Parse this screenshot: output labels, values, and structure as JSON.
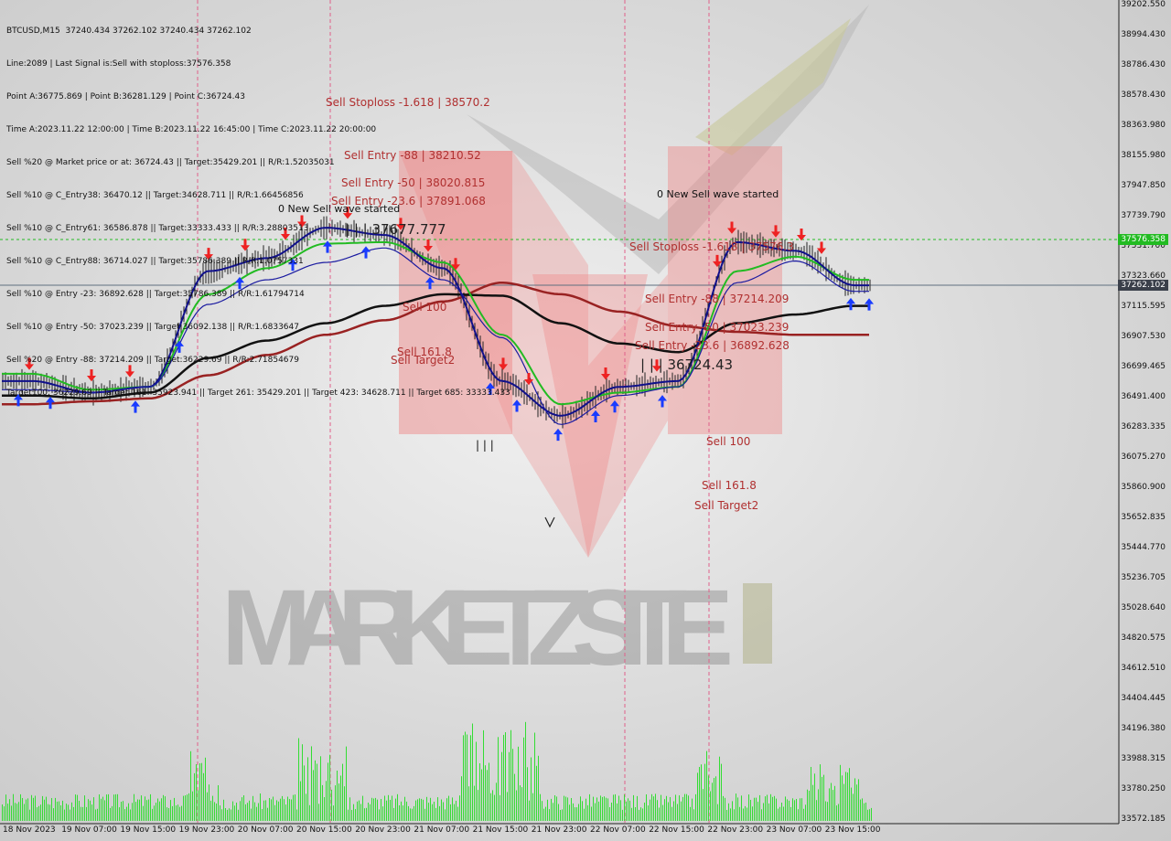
{
  "symbol_line": "BTCUSD,M15  37240.434 37262.102 37240.434 37262.102",
  "info_lines": [
    "Line:2089 | Last Signal is:Sell with stoploss:37576.358",
    "Point A:36775.869 | Point B:36281.129 | Point C:36724.43",
    "Time A:2023.11.22 12:00:00 | Time B:2023.11.22 16:45:00 | Time C:2023.11.22 20:00:00",
    "Sell %20 @ Market price or at: 36724.43 || Target:35429.201 || R/R:1.52035031",
    "Sell %10 @ C_Entry38: 36470.12 || Target:34628.711 || R/R:1.66456856",
    "Sell %10 @ C_Entry61: 36586.878 || Target:33333.433 || R/R:3.28803513",
    "Sell %10 @ C_Entry88: 36714.027 || Target:35786.389 || R/R:1.0757331",
    "Sell %10 @ Entry -23: 36892.628 || Target:35786.389 || R/R:1.61794714",
    "Sell %10 @ Entry -50: 37023.239 || Target:36092.138 || R/R:1.6833647",
    "Sell %20 @ Entry -88: 37214.209 || Target:36229.69 || R/R:2.71854679",
    "Target100: 36229.69 || Target 161: 35923.941 || Target 261: 35429.201 || Target 423: 34628.711 || Target 685: 33333.433"
  ],
  "chart_labels": {
    "left_stoploss": "Sell Stoploss -1.618 | 38570.2",
    "left_entry88": "Sell Entry -88 | 38210.52",
    "left_entry50": "Sell Entry -50 | 38020.815",
    "left_entry236": "Sell Entry -23.6 | 37891.068",
    "left_wave": "0 New Sell wave started",
    "left_price": "| | | 37677.777",
    "left_sell100": "Sell 100",
    "left_sell1618": "Sell 161.8",
    "left_target2": "Sell Target2",
    "left_ticks": "| | |",
    "right_wave": "0 New Sell wave started",
    "right_stoploss": "Sell Stoploss -1.618 | 37576.3",
    "right_entry88": "Sell Entry -88 | 37214.209",
    "right_entry50": "Sell Entry -50 | 37023.239",
    "right_entry236": "Sell Entry -23.6 | 36892.628",
    "right_price": "| | | 36724.43",
    "right_sell100": "Sell 100",
    "right_sell1618": "Sell 161.8",
    "right_target2": "Sell Target2"
  },
  "watermark": "MARKETZ SITE",
  "price_axis": [
    "39202.550",
    "38994.430",
    "38786.430",
    "38578.430",
    "38363.980",
    "38155.980",
    "37947.850",
    "37739.790",
    "37531.700",
    "37323.660",
    "37115.595",
    "36907.530",
    "36699.465",
    "36491.400",
    "36283.335",
    "36075.270",
    "35860.900",
    "35652.835",
    "35444.770",
    "35236.705",
    "35028.640",
    "34820.575",
    "34612.510",
    "34404.445",
    "34196.380",
    "33988.315",
    "33780.250",
    "33572.185"
  ],
  "time_axis": [
    "18 Nov 2023",
    "19 Nov 07:00",
    "19 Nov 15:00",
    "19 Nov 23:00",
    "20 Nov 07:00",
    "20 Nov 15:00",
    "20 Nov 23:00",
    "21 Nov 07:00",
    "21 Nov 15:00",
    "21 Nov 23:00",
    "22 Nov 07:00",
    "22 Nov 15:00",
    "22 Nov 23:00",
    "23 Nov 07:00",
    "23 Nov 15:00"
  ],
  "current_price": "37262.102",
  "stoploss_price": "37576.358",
  "colors": {
    "sell_zone": "#f08080",
    "sell_text": "#b03030",
    "volume": "#33dd33",
    "ma_green": "#22bb22",
    "ma_blue": "#10108a",
    "ma_black": "#111111",
    "ma_red": "#992222",
    "vline": "#e0608a",
    "stoploss_line": "#22bb22",
    "price_line": "#607080",
    "price_box": "#3a3f4a"
  },
  "chart_data": {
    "type": "line",
    "title": "BTCUSD,M15",
    "x": [
      "18 Nov 2023",
      "19 Nov 07:00",
      "19 Nov 15:00",
      "19 Nov 23:00",
      "20 Nov 07:00",
      "20 Nov 15:00",
      "20 Nov 23:00",
      "21 Nov 07:00",
      "21 Nov 15:00",
      "21 Nov 23:00",
      "22 Nov 07:00",
      "22 Nov 15:00",
      "22 Nov 23:00",
      "23 Nov 07:00",
      "23 Nov 15:00"
    ],
    "ylim": [
      33572.185,
      39202.55
    ],
    "series": [
      {
        "values": [
          36600,
          36520,
          36560,
          37360,
          37450,
          37660,
          37610,
          37380,
          36600,
          36360,
          36560,
          36600,
          37560,
          37500,
          37262
        ]
      },
      {
        "values": [
          36650,
          36540,
          36560,
          37200,
          37380,
          37550,
          37560,
          37420,
          36920,
          36440,
          36520,
          36560,
          37360,
          37460,
          37300
        ]
      },
      {
        "values": [
          36540,
          36520,
          36560,
          37130,
          37300,
          37420,
          37520,
          37300,
          36900,
          36300,
          36500,
          36560,
          37280,
          37430,
          37220
        ]
      },
      {
        "values": [
          36500,
          36480,
          36520,
          36760,
          36880,
          37000,
          37120,
          37200,
          37190,
          37000,
          36860,
          36800,
          37000,
          37060,
          37120
        ]
      },
      {
        "values": [
          36440,
          36460,
          36480,
          36640,
          36780,
          36920,
          37020,
          37150,
          37280,
          37200,
          37080,
          36980,
          36940,
          36920,
          36920
        ]
      }
    ]
  }
}
